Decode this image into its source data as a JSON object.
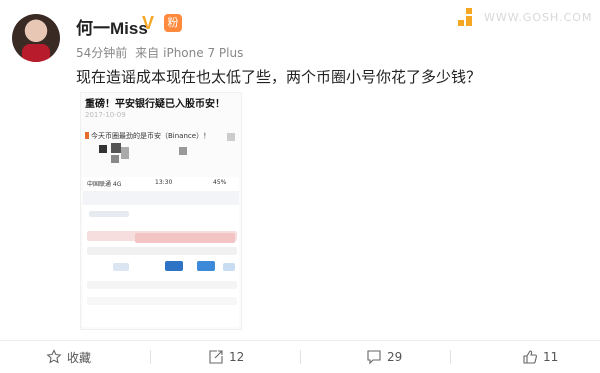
{
  "post": {
    "username": "何一Miss",
    "verified_mark": "V",
    "fan_badge": "粉",
    "time": "54分钟前",
    "source_prefix": "来自",
    "device": "iPhone 7 Plus",
    "text": "现在造谣成本现在也太低了些，两个币圈小号你花了多少钱？"
  },
  "watermark": {
    "text": "WWW.GOSH.COM"
  },
  "embedded_screenshot": {
    "headline": "重磅！平安银行疑已入股币安！",
    "date": "2017-10-09",
    "subtitle": "今天币圈最劲的是币安（Binance）！",
    "carrier": "中国联通 4G",
    "clock": "13:30",
    "battery": "45%"
  },
  "actions": {
    "favorite_label": "收藏",
    "repost_count": "12",
    "comment_count": "29",
    "like_count": "11"
  },
  "colors": {
    "accent": "#f5a623",
    "text": "#222222",
    "meta": "#888888"
  }
}
